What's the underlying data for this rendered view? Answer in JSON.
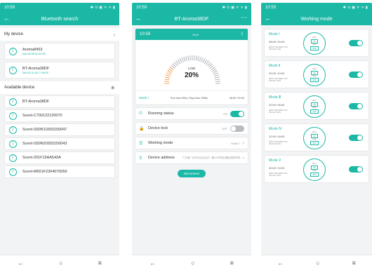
{
  "status": {
    "time": "10:59",
    "icons": "✱ ⊙ ▣ ᯤ ᯤ ▮"
  },
  "panel1": {
    "title": "Bluetooth search",
    "my_device_label": "My device",
    "my_devices": [
      {
        "name": "Aroma8453",
        "mac": "Mac:A6:0E:8C:8F:B3"
      },
      {
        "name": "BT-Aroma38DF",
        "mac": "Mac:5C:51:84:77:9B:DF"
      }
    ],
    "available_label": "Available device",
    "available_devices": [
      "BT-Aroma38DF",
      "Scent-C700122120070",
      "Scent-S50N10303150047",
      "Scent-S50N20303150043",
      "Scent-201F15AA543A",
      "Scent-M501F2304070050"
    ]
  },
  "panel2": {
    "title": "BT-Aroma38DF",
    "card_time": "10:59",
    "card_status": "RUN",
    "level_label": "LOW",
    "level_percent": "20%",
    "level_fraction": 0.2,
    "mode_label": "Mode Ⅰ",
    "run_info": "Run time 5Ms  |  Stop time 30Ms",
    "card_right_time": "08:00~20:00",
    "running_status_label": "Running status",
    "running_status_value": "ON",
    "device_lock_label": "Device lock",
    "device_lock_value": "OFF",
    "working_mode_label": "Working mode",
    "working_mode_value": "Mode Ⅰ",
    "device_address_label": "Device address",
    "device_address_value": "广东省广州市白云区石井一路123号双边路信息研究所",
    "disconnect_label": "Disconnect"
  },
  "panel3": {
    "title": "Working mode",
    "modes": [
      {
        "name": "Mode Ⅰ",
        "time": "08:00~20:00",
        "days": "MON TUE WED THU FRI SAT SUN",
        "run": "5S",
        "stop": "30S"
      },
      {
        "name": "Mode Ⅱ",
        "time": "20:00~10:00",
        "days": "MON TUE WED THU FRI SAT SUN",
        "run": "5S",
        "stop": "30S"
      },
      {
        "name": "Mode Ⅲ",
        "time": "20:00~06:00",
        "days": "MON TUE WED THU FRI SAT SUN",
        "run": "5S",
        "stop": "30S"
      },
      {
        "name": "Mode Ⅳ",
        "time": "12:00~18:00",
        "days": "MON TUE WED THU FRI SAT SUN",
        "run": "5S",
        "stop": "30S"
      },
      {
        "name": "Mode Ⅴ",
        "time": "00:00~10:00",
        "days": "MON TUE WED THU FRI SAT SUN",
        "run": "5S",
        "stop": "30S"
      }
    ],
    "run_label": "Run",
    "stop_label": "Stop"
  },
  "nav": {
    "back": "←",
    "home": "○",
    "menu": "≡"
  },
  "colors": {
    "accent": "#1bb8a6"
  }
}
